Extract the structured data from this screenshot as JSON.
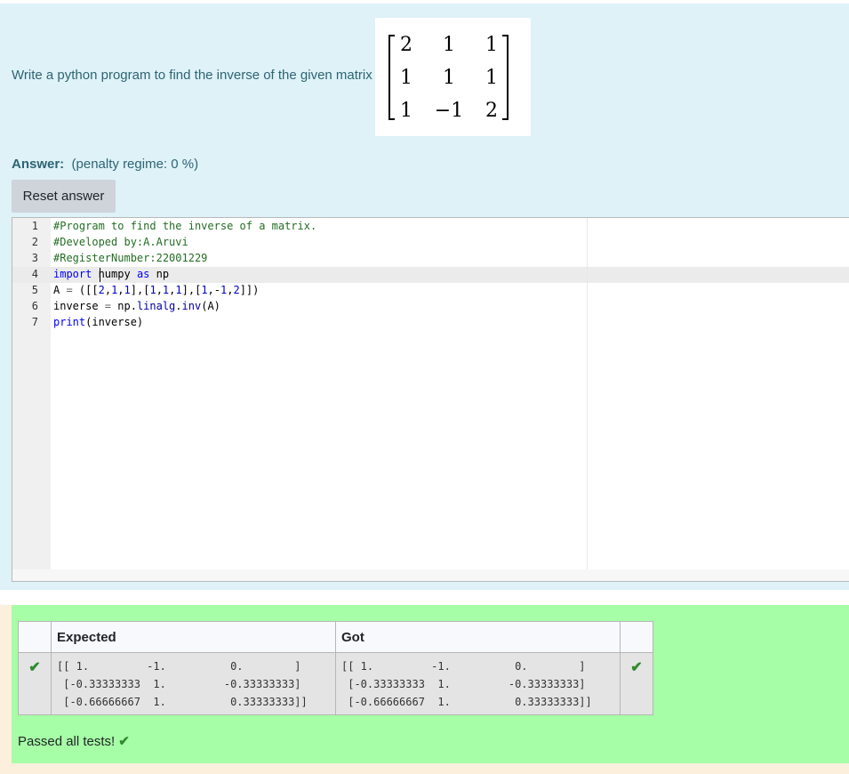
{
  "question": {
    "text": "Write a python program to find the inverse of the given matrix",
    "matrix": [
      [
        "2",
        "1",
        "1"
      ],
      [
        "1",
        "1",
        "1"
      ],
      [
        "1",
        "−1",
        "2"
      ]
    ]
  },
  "answer": {
    "label": "Answer:",
    "penalty": "(penalty regime: 0 %)",
    "reset_label": "Reset answer"
  },
  "editor": {
    "line_numbers": [
      "1",
      "2",
      "3",
      "4",
      "5",
      "6",
      "7"
    ],
    "lines": [
      "#Program to find the inverse of a matrix.",
      "#Developed by:A.Aruvi",
      "#RegisterNumber:22001229",
      "import numpy as np",
      "A = ([[2,1,1],[1,1,1],[1,-1,2]])",
      "inverse = np.linalg.inv(A)",
      "print(inverse)"
    ]
  },
  "results": {
    "headers": [
      "",
      "Expected",
      "Got",
      ""
    ],
    "expected": "[[ 1.         -1.          0.        ]\n [-0.33333333  1.         -0.33333333]\n [-0.66666667  1.          0.33333333]]",
    "got": "[[ 1.         -1.          0.        ]\n [-0.33333333  1.         -0.33333333]\n [-0.66666667  1.          0.33333333]]",
    "status_icon": "check-icon",
    "passed_text": "Passed all tests!"
  },
  "colors": {
    "question_bg": "#def2f8",
    "result_bg": "#fcefdc",
    "pass_bg": "#a6ffa6",
    "check": "#2e8b2e"
  }
}
